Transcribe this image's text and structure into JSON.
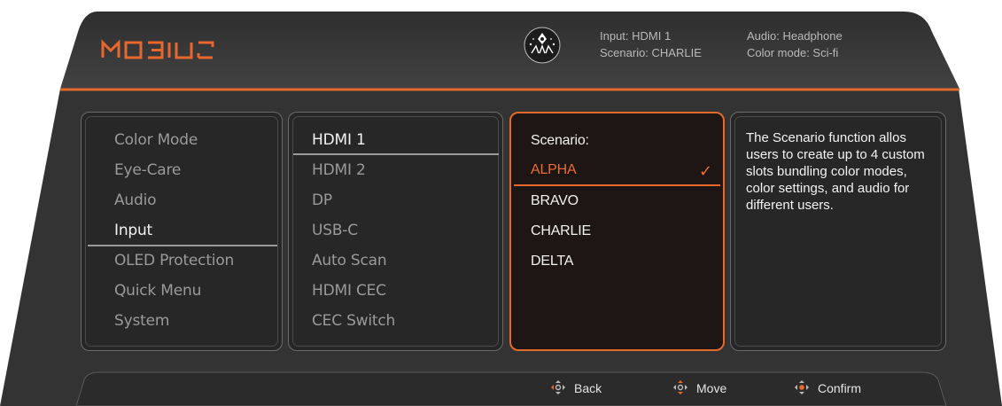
{
  "header": {
    "brand": "MOBIUZ",
    "input_line": "Input: HDMI 1",
    "scenario_line": "Scenario: CHARLIE",
    "audio_line": "Audio: Headphone",
    "color_mode_line": "Color mode: Sci-fi"
  },
  "menu": {
    "items": [
      "Color Mode",
      "Eye-Care",
      "Audio",
      "Input",
      "OLED Protection",
      "Quick Menu",
      "System"
    ],
    "selected": "Input"
  },
  "submenu": {
    "items": [
      "HDMI 1",
      "HDMI 2",
      "DP",
      "USB-C",
      "Auto Scan",
      "HDMI CEC",
      "CEC Switch"
    ],
    "selected": "HDMI 1"
  },
  "scenario": {
    "title": "Scenario:",
    "items": [
      "ALPHA",
      "BRAVO",
      "CHARLIE",
      "DELTA"
    ],
    "active": "ALPHA"
  },
  "description": {
    "text": "The Scenario function allos users to create up to 4 custom slots bundling color modes, color settings, and audio for different users."
  },
  "footer": {
    "back_label": "Back",
    "move_label": "Move",
    "confirm_label": "Confirm"
  },
  "colors": {
    "accent": "#e8672c",
    "frame": "#3a3a3a",
    "panel": "#272727"
  }
}
